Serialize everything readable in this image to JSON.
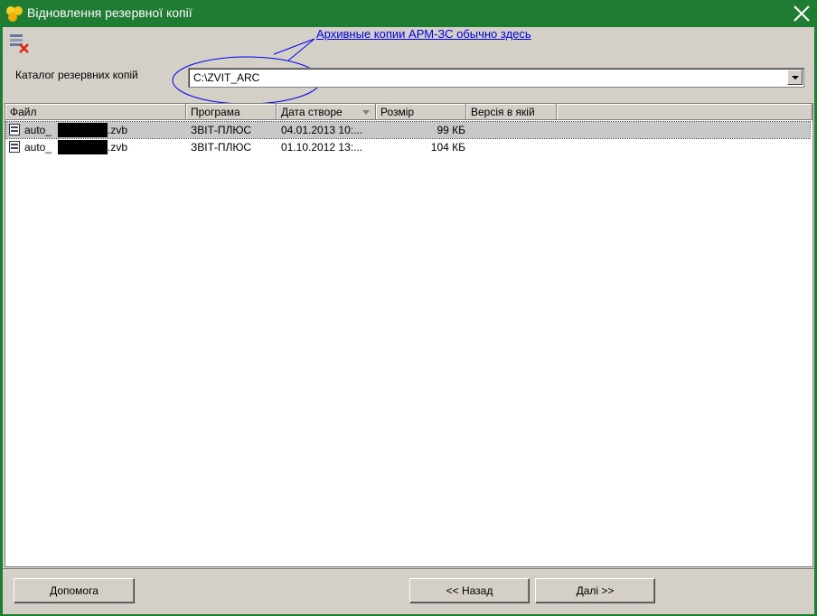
{
  "window": {
    "title": "Відновлення резервної копії"
  },
  "annotation": {
    "text": "Архивные копии АРМ-ЗС обычно здесь"
  },
  "catalog": {
    "label": "Каталог резервних копій",
    "value": "C:\\ZVIT_ARC"
  },
  "table": {
    "columns": [
      "Файл",
      "Програма",
      "Дата створе",
      "Розмір",
      "Версія в якій"
    ],
    "rows": [
      {
        "file_prefix": "auto_",
        "file_suffix": ".zvb",
        "program": "ЗВІТ-ПЛЮС",
        "date": "04.01.2013  10:...",
        "size": "99 КБ",
        "version": ""
      },
      {
        "file_prefix": "auto_",
        "file_suffix": ".zvb",
        "program": "ЗВІТ-ПЛЮС",
        "date": "01.10.2012  13:...",
        "size": "104 КБ",
        "version": ""
      }
    ]
  },
  "buttons": {
    "help": "Допомога",
    "back": "<< Назад",
    "next": "Далі >>"
  },
  "colors": {
    "titlebar": "#1e7d32",
    "annotation": "#0000ee",
    "face": "#d4d0c8"
  }
}
